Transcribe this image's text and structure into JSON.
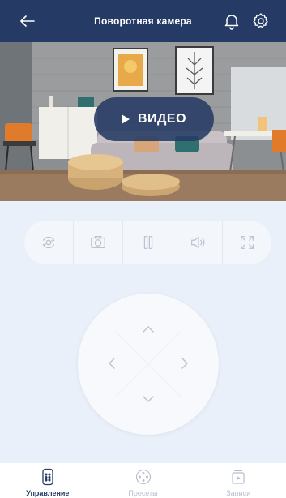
{
  "header": {
    "title": "Поворотная камера",
    "back_icon": "arrow-left-icon",
    "bell_icon": "bell-icon",
    "settings_icon": "gear-icon"
  },
  "video": {
    "play_label": "ВИДЕО",
    "play_icon": "play-icon"
  },
  "controls": [
    {
      "name": "rotate-camera-button",
      "icon": "rotate-icon"
    },
    {
      "name": "snapshot-button",
      "icon": "camera-icon"
    },
    {
      "name": "pause-button",
      "icon": "pause-icon"
    },
    {
      "name": "sound-button",
      "icon": "speaker-icon"
    },
    {
      "name": "fullscreen-button",
      "icon": "fullscreen-icon"
    }
  ],
  "joystick": {
    "up_icon": "chevron-up-icon",
    "down_icon": "chevron-down-icon",
    "left_icon": "chevron-left-icon",
    "right_icon": "chevron-right-icon"
  },
  "nav": {
    "items": [
      {
        "label": "Управление",
        "icon": "remote-icon",
        "active": true
      },
      {
        "label": "Пресеты",
        "icon": "presets-icon",
        "active": false
      },
      {
        "label": "Записи",
        "icon": "recordings-icon",
        "active": false
      }
    ]
  },
  "colors": {
    "header_bg": "#253a64",
    "page_bg": "#e9f0f9",
    "accent": "#253a64",
    "inactive": "#b7bfcc"
  }
}
